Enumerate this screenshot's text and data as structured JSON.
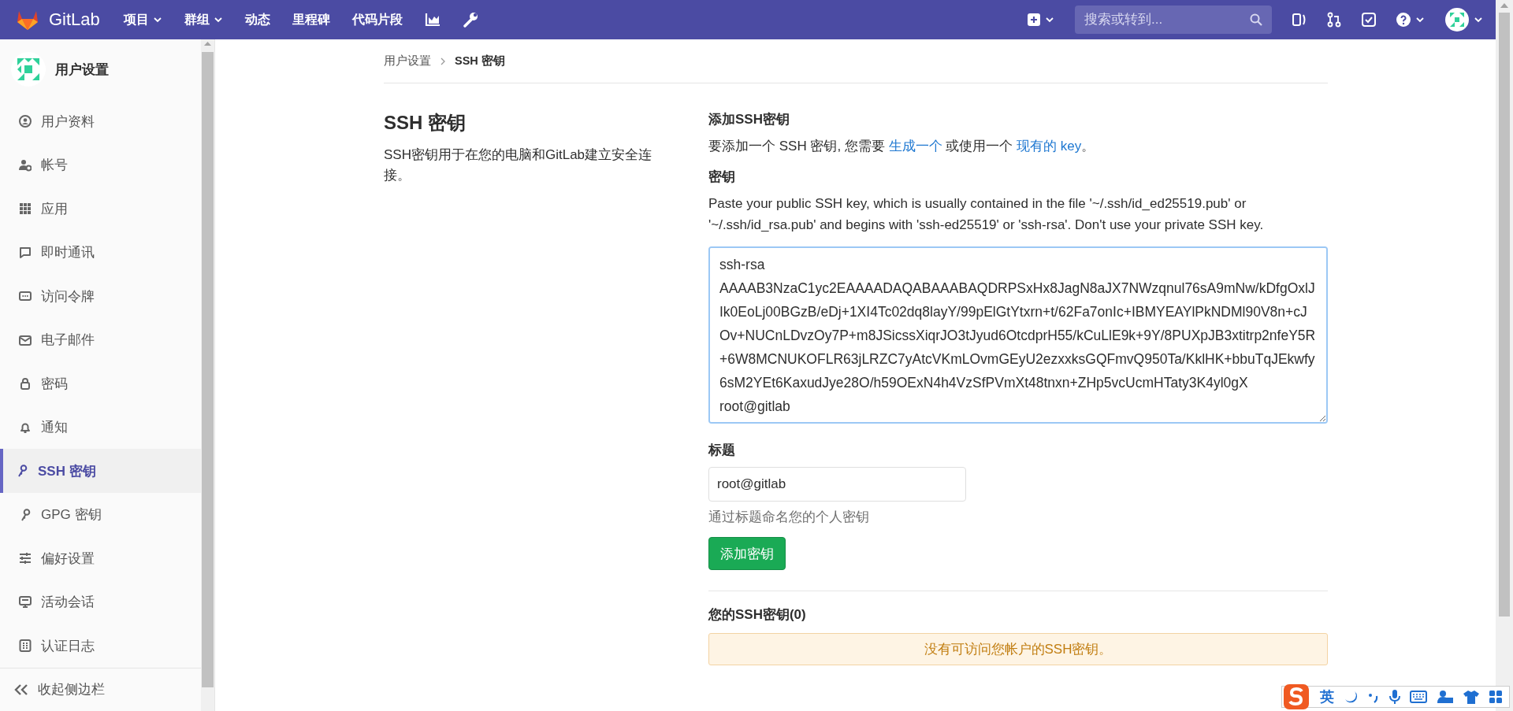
{
  "topbar": {
    "brand": "GitLab",
    "nav": [
      {
        "label": "项目",
        "dropdown": true
      },
      {
        "label": "群组",
        "dropdown": true
      },
      {
        "label": "动态",
        "dropdown": false
      },
      {
        "label": "里程碑",
        "dropdown": false
      },
      {
        "label": "代码片段",
        "dropdown": false
      }
    ],
    "search": {
      "placeholder": "搜索或转到..."
    }
  },
  "sidebar": {
    "title": "用户设置",
    "items": [
      {
        "label": "用户资料",
        "selected": false
      },
      {
        "label": "帐号",
        "selected": false
      },
      {
        "label": "应用",
        "selected": false
      },
      {
        "label": "即时通讯",
        "selected": false
      },
      {
        "label": "访问令牌",
        "selected": false
      },
      {
        "label": "电子邮件",
        "selected": false
      },
      {
        "label": "密码",
        "selected": false
      },
      {
        "label": "通知",
        "selected": false
      },
      {
        "label": "SSH 密钥",
        "selected": true
      },
      {
        "label": "GPG 密钥",
        "selected": false
      },
      {
        "label": "偏好设置",
        "selected": false
      },
      {
        "label": "活动会话",
        "selected": false
      },
      {
        "label": "认证日志",
        "selected": false
      }
    ],
    "collapse": "收起侧边栏"
  },
  "breadcrumb": [
    "用户设置",
    "SSH 密钥"
  ],
  "intro": {
    "title": "SSH 密钥",
    "description": "SSH密钥用于在您的电脑和GitLab建立安全连接。"
  },
  "form": {
    "heading": "添加SSH密钥",
    "text_before": "要添加一个 SSH 密钥, 您需要 ",
    "link_generate": "生成一个",
    "text_middle": " 或使用一个 ",
    "link_existing": "现有的 key",
    "text_after": "。",
    "key_label": "密钥",
    "key_help": "Paste your public SSH key, which is usually contained in the file '~/.ssh/id_ed25519.pub' or '~/.ssh/id_rsa.pub' and begins with 'ssh-ed25519' or 'ssh-rsa'. Don't use your private SSH key.",
    "key_value": "ssh-rsa AAAAB3NzaC1yc2EAAAADAQABAAABAQDRPSxHx8JagN8aJX7NWzqnul76sA9mNw/kDfgOxlJIk0EoLj00BGzB/eDj+1XI4Tc02dq8layY/99pElGtYtxrn+t/62Fa7onIc+IBMYEAYlPkNDMl90V8n+cJOv+NUCnLDvzOy7P+m8JSicssXiqrJO3tJyud6OtcdprH55/kCuLlE9k+9Y/8PUXpJB3xtitrp2nfeY5R+6W8MCNUKOFLR63jLRZC7yAtcVKmLOvmGEyU2ezxxksGQFmvQ950Ta/KklHK+bbuTqJEkwfy6sM2YEt6KaxudJye28O/h59OExN4h4VzSfPVmXt48tnxn+ZHp5vcUcmHTaty3K4yl0gX root@gitlab",
    "title_label": "标题",
    "title_value": "root@gitlab",
    "title_hint": "通过标题命名您的个人密钥",
    "submit": "添加密钥"
  },
  "keys": {
    "heading": "您的SSH密钥(0)",
    "empty_message": "没有可访问您帐户的SSH密钥。"
  },
  "ime_bar": {
    "mode": "英"
  }
}
